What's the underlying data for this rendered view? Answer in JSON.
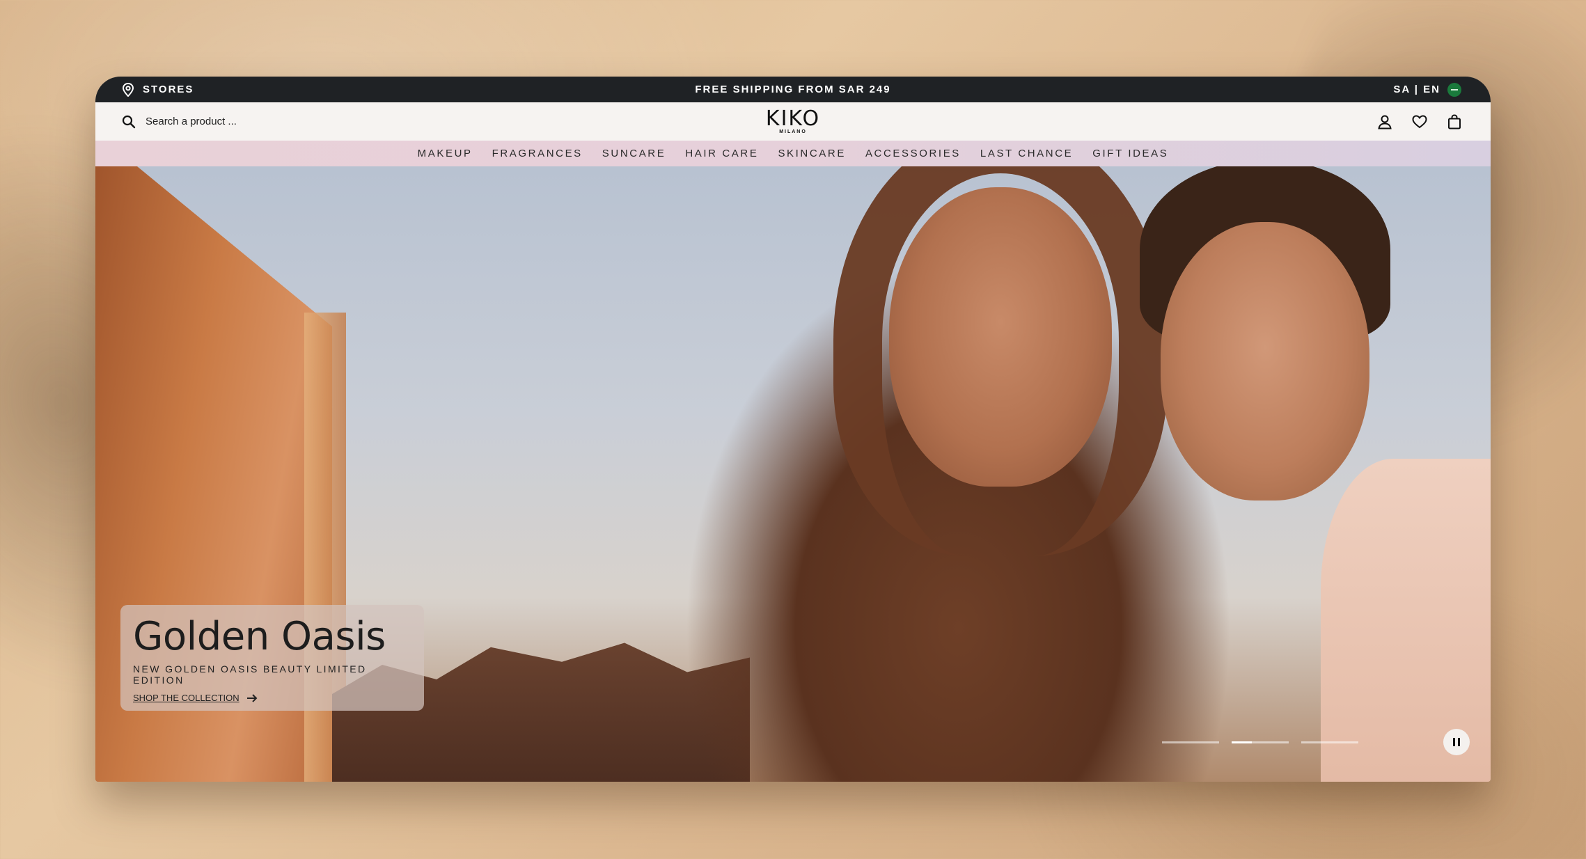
{
  "topbar": {
    "stores_label": "STORES",
    "promo_text": "FREE SHIPPING FROM SAR 249",
    "locale": "SA | EN",
    "bg_color": "#1f2225"
  },
  "header": {
    "search_placeholder": "Search a product ...",
    "logo_text": "KIKO",
    "logo_sub": "MILANO",
    "icons": [
      "account-icon",
      "wishlist-heart-icon",
      "shopping-bag-icon"
    ]
  },
  "categories": [
    "MAKEUP",
    "FRAGRANCES",
    "SUNCARE",
    "HAIR CARE",
    "SKINCARE",
    "ACCESSORIES",
    "LAST CHANCE",
    "GIFT IDEAS"
  ],
  "hero": {
    "title": "Golden Oasis",
    "subtitle": "NEW GOLDEN OASIS BEAUTY LIMITED EDITION",
    "cta": "SHOP THE COLLECTION",
    "slides_total": 3,
    "active_slide": 2,
    "active_slide_progress": 0.35
  }
}
